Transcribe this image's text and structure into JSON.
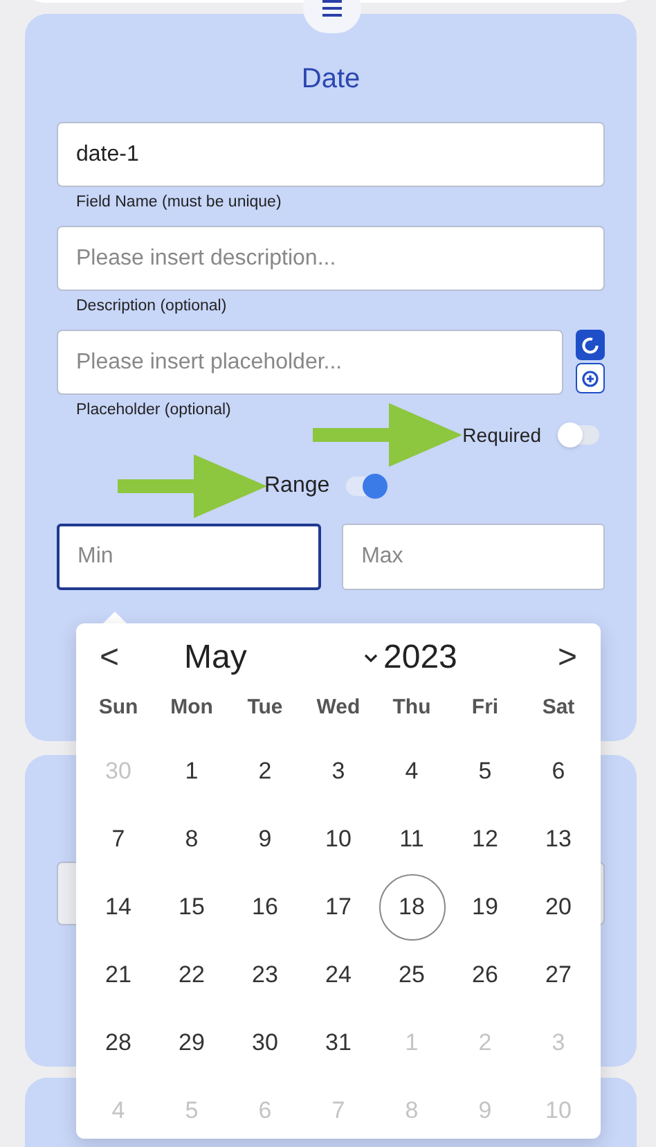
{
  "date_card": {
    "title": "Date",
    "fields": [
      {
        "value": "date-1",
        "helper": "Field Name (must be unique)"
      },
      {
        "placeholder": "Please insert description...",
        "helper": "Description (optional)"
      },
      {
        "placeholder": "Please insert placeholder...",
        "helper": "Placeholder (optional)",
        "side_buttons": true
      }
    ],
    "required": {
      "label": "Required",
      "on": false
    },
    "range": {
      "label": "Range",
      "on": true
    },
    "min": {
      "placeholder": "Min",
      "focused": true
    },
    "max": {
      "placeholder": "Max",
      "focused": false
    }
  },
  "calendar": {
    "month": "May",
    "year": "2023",
    "prev": "<",
    "next": ">",
    "weekdays": [
      "Sun",
      "Mon",
      "Tue",
      "Wed",
      "Thu",
      "Fri",
      "Sat"
    ],
    "days": [
      {
        "label": "30",
        "outside": true,
        "selected": false
      },
      {
        "label": "1",
        "outside": false,
        "selected": false
      },
      {
        "label": "2",
        "outside": false,
        "selected": false
      },
      {
        "label": "3",
        "outside": false,
        "selected": false
      },
      {
        "label": "4",
        "outside": false,
        "selected": false
      },
      {
        "label": "5",
        "outside": false,
        "selected": false
      },
      {
        "label": "6",
        "outside": false,
        "selected": false
      },
      {
        "label": "7",
        "outside": false,
        "selected": false
      },
      {
        "label": "8",
        "outside": false,
        "selected": false
      },
      {
        "label": "9",
        "outside": false,
        "selected": false
      },
      {
        "label": "10",
        "outside": false,
        "selected": false
      },
      {
        "label": "11",
        "outside": false,
        "selected": false
      },
      {
        "label": "12",
        "outside": false,
        "selected": false
      },
      {
        "label": "13",
        "outside": false,
        "selected": false
      },
      {
        "label": "14",
        "outside": false,
        "selected": false
      },
      {
        "label": "15",
        "outside": false,
        "selected": false
      },
      {
        "label": "16",
        "outside": false,
        "selected": false
      },
      {
        "label": "17",
        "outside": false,
        "selected": false
      },
      {
        "label": "18",
        "outside": false,
        "selected": true
      },
      {
        "label": "19",
        "outside": false,
        "selected": false
      },
      {
        "label": "20",
        "outside": false,
        "selected": false
      },
      {
        "label": "21",
        "outside": false,
        "selected": false
      },
      {
        "label": "22",
        "outside": false,
        "selected": false
      },
      {
        "label": "23",
        "outside": false,
        "selected": false
      },
      {
        "label": "24",
        "outside": false,
        "selected": false
      },
      {
        "label": "25",
        "outside": false,
        "selected": false
      },
      {
        "label": "26",
        "outside": false,
        "selected": false
      },
      {
        "label": "27",
        "outside": false,
        "selected": false
      },
      {
        "label": "28",
        "outside": false,
        "selected": false
      },
      {
        "label": "29",
        "outside": false,
        "selected": false
      },
      {
        "label": "30",
        "outside": false,
        "selected": false
      },
      {
        "label": "31",
        "outside": false,
        "selected": false
      },
      {
        "label": "1",
        "outside": true,
        "selected": false
      },
      {
        "label": "2",
        "outside": true,
        "selected": false
      },
      {
        "label": "3",
        "outside": true,
        "selected": false
      },
      {
        "label": "4",
        "outside": true,
        "selected": false
      },
      {
        "label": "5",
        "outside": true,
        "selected": false
      },
      {
        "label": "6",
        "outside": true,
        "selected": false
      },
      {
        "label": "7",
        "outside": true,
        "selected": false
      },
      {
        "label": "8",
        "outside": true,
        "selected": false
      },
      {
        "label": "9",
        "outside": true,
        "selected": false
      },
      {
        "label": "10",
        "outside": true,
        "selected": false
      }
    ]
  }
}
